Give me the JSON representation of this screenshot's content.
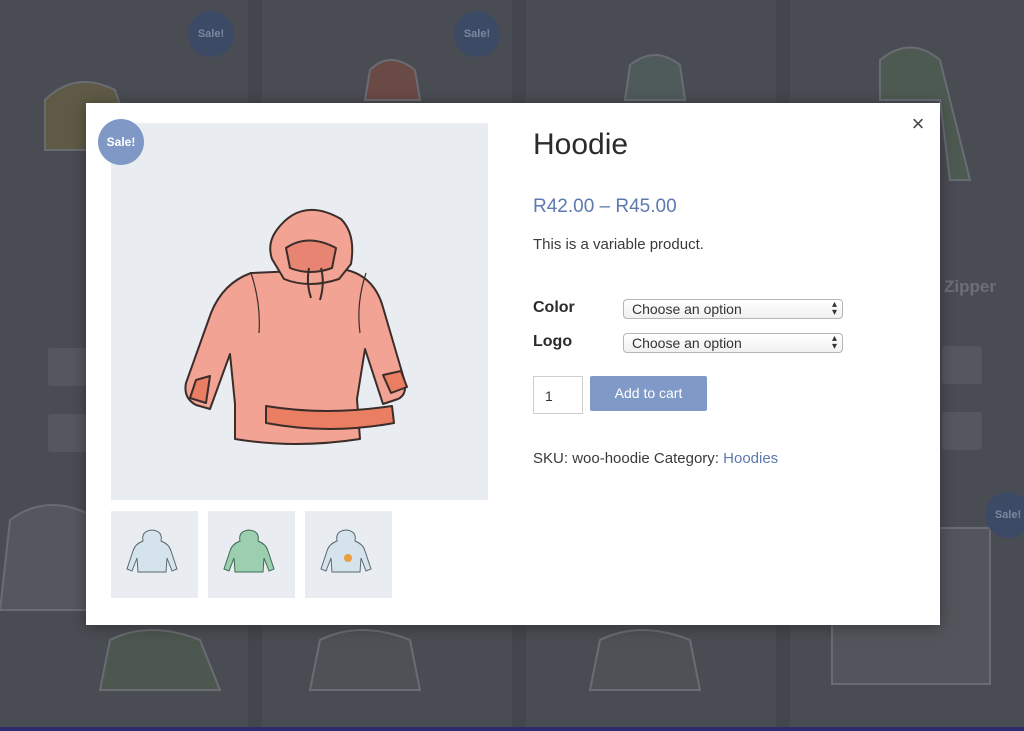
{
  "background": {
    "sale_badges": [
      "Sale!",
      "Sale!",
      "Sale!"
    ],
    "partial_title": "Zipper"
  },
  "product": {
    "sale_badge": "Sale!",
    "title": "Hoodie",
    "price": "R42.00 – R45.00",
    "description": "This is a variable product.",
    "variations": [
      {
        "label": "Color",
        "selected": "Choose an option"
      },
      {
        "label": "Logo",
        "selected": "Choose an option"
      }
    ],
    "quantity": "1",
    "add_to_cart": "Add to cart",
    "sku_label": "SKU:",
    "sku": "woo-hoodie",
    "category_label": "Category:",
    "category": "Hoodies",
    "thumbnails": [
      "hoodie-blue",
      "hoodie-green",
      "hoodie-with-logo"
    ]
  },
  "close_icon": "×",
  "colors": {
    "accent": "#5e79b0",
    "button": "#809ac7",
    "sale_badge": "#7f98c6",
    "image_bg": "#e9ecf1",
    "overlay": "#44464d"
  }
}
